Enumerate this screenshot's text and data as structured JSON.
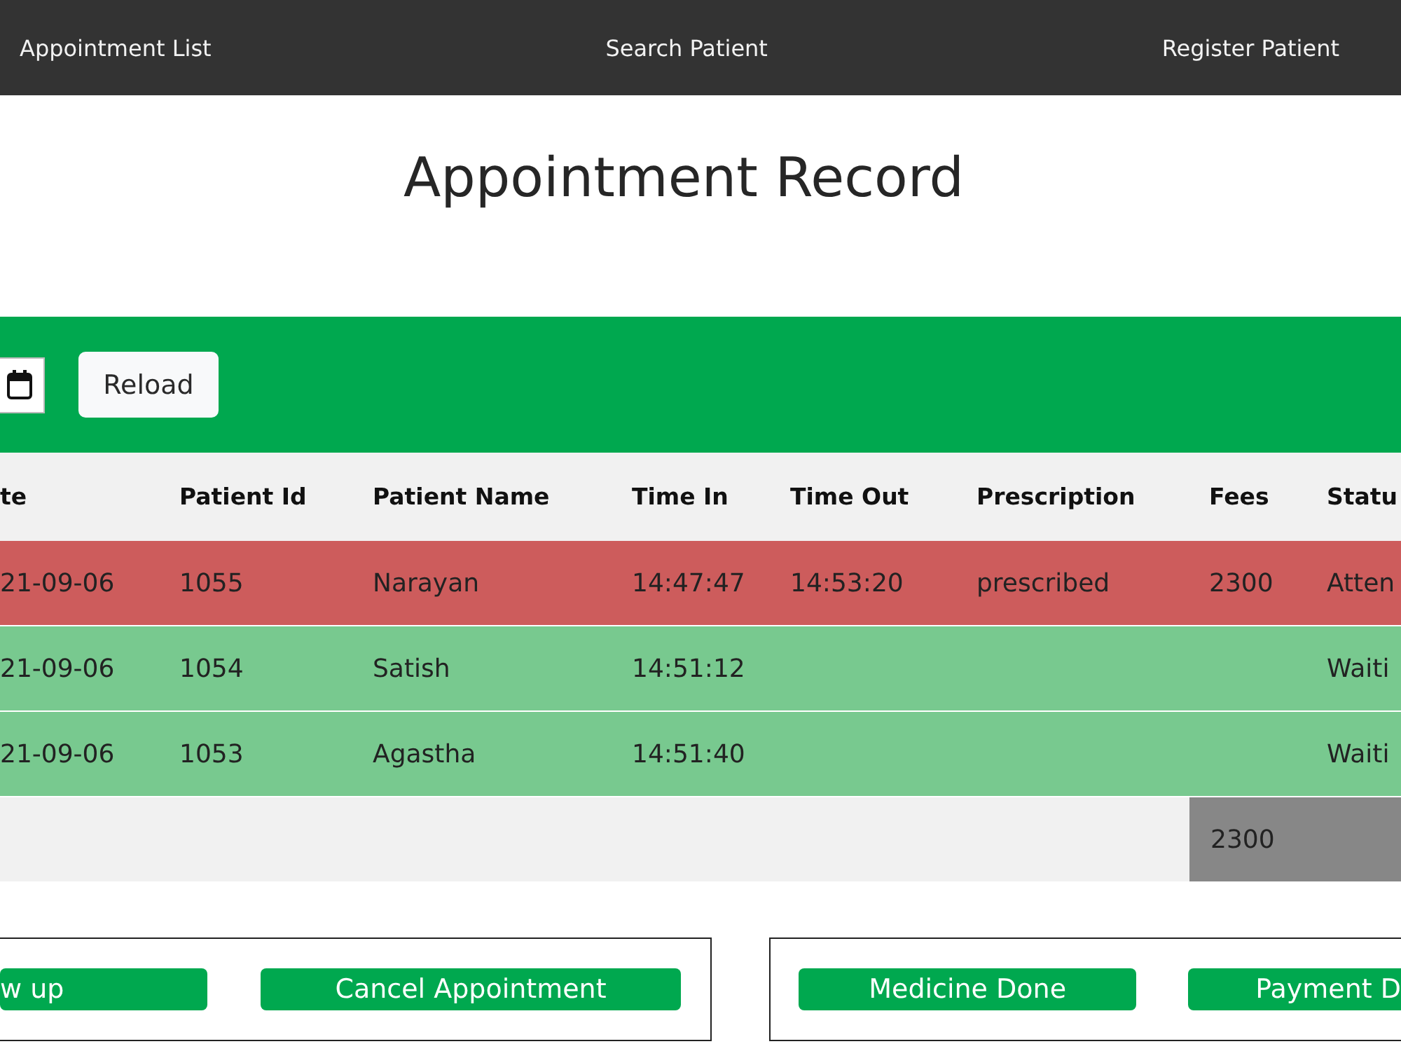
{
  "nav": {
    "links": [
      "Appointment List",
      "Search Patient",
      "Register Patient"
    ]
  },
  "title": "Appointment Record",
  "filter_bar": {
    "reload_button": "Reload"
  },
  "table": {
    "columns": [
      "te",
      "Patient Id",
      "Patient Name",
      "Time In",
      "Time Out",
      "Prescription",
      "Fees",
      "Statu"
    ],
    "rows": [
      {
        "color": "#cd5c5c",
        "cells": [
          "21-09-06",
          "1055",
          "Narayan",
          "14:47:47",
          "14:53:20",
          "prescribed",
          "2300",
          "Atten"
        ]
      },
      {
        "color": "#78c98f",
        "cells": [
          "21-09-06",
          "1054",
          "Satish",
          "14:51:12",
          null,
          null,
          null,
          "Waiti"
        ]
      },
      {
        "color": "#78c98f",
        "cells": [
          "21-09-06",
          "1053",
          "Agastha",
          "14:51:40",
          null,
          null,
          null,
          "Waiti"
        ]
      }
    ],
    "total": {
      "fees": "2300"
    }
  },
  "action_panels": [
    {
      "buttons": [
        "w up",
        "Cancel Appointment"
      ]
    },
    {
      "buttons": [
        "Medicine Done",
        "Payment D"
      ]
    }
  ]
}
